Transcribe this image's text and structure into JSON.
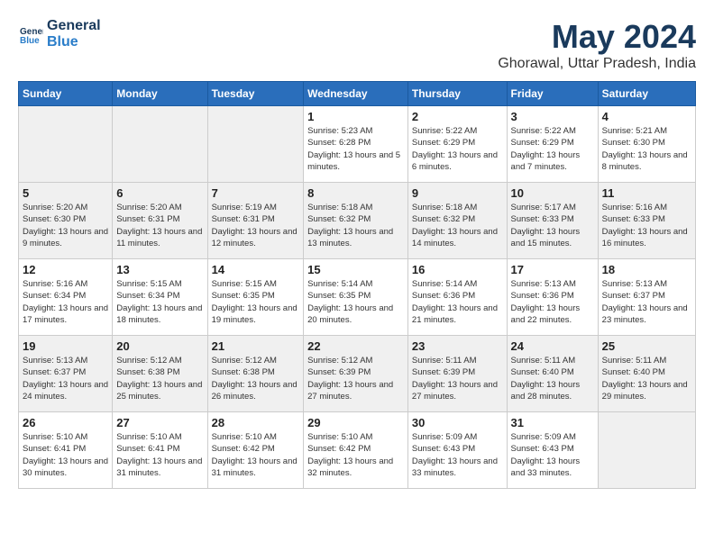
{
  "logo": {
    "line1": "General",
    "line2": "Blue"
  },
  "title": "May 2024",
  "subtitle": "Ghorawal, Uttar Pradesh, India",
  "days_of_week": [
    "Sunday",
    "Monday",
    "Tuesday",
    "Wednesday",
    "Thursday",
    "Friday",
    "Saturday"
  ],
  "weeks": [
    {
      "days": [
        {
          "num": "",
          "empty": true
        },
        {
          "num": "",
          "empty": true
        },
        {
          "num": "",
          "empty": true
        },
        {
          "num": "1",
          "sunrise": "5:23 AM",
          "sunset": "6:28 PM",
          "daylight": "13 hours and 5 minutes."
        },
        {
          "num": "2",
          "sunrise": "5:22 AM",
          "sunset": "6:29 PM",
          "daylight": "13 hours and 6 minutes."
        },
        {
          "num": "3",
          "sunrise": "5:22 AM",
          "sunset": "6:29 PM",
          "daylight": "13 hours and 7 minutes."
        },
        {
          "num": "4",
          "sunrise": "5:21 AM",
          "sunset": "6:30 PM",
          "daylight": "13 hours and 8 minutes."
        }
      ]
    },
    {
      "days": [
        {
          "num": "5",
          "sunrise": "5:20 AM",
          "sunset": "6:30 PM",
          "daylight": "13 hours and 9 minutes."
        },
        {
          "num": "6",
          "sunrise": "5:20 AM",
          "sunset": "6:31 PM",
          "daylight": "13 hours and 11 minutes."
        },
        {
          "num": "7",
          "sunrise": "5:19 AM",
          "sunset": "6:31 PM",
          "daylight": "13 hours and 12 minutes."
        },
        {
          "num": "8",
          "sunrise": "5:18 AM",
          "sunset": "6:32 PM",
          "daylight": "13 hours and 13 minutes."
        },
        {
          "num": "9",
          "sunrise": "5:18 AM",
          "sunset": "6:32 PM",
          "daylight": "13 hours and 14 minutes."
        },
        {
          "num": "10",
          "sunrise": "5:17 AM",
          "sunset": "6:33 PM",
          "daylight": "13 hours and 15 minutes."
        },
        {
          "num": "11",
          "sunrise": "5:16 AM",
          "sunset": "6:33 PM",
          "daylight": "13 hours and 16 minutes."
        }
      ]
    },
    {
      "days": [
        {
          "num": "12",
          "sunrise": "5:16 AM",
          "sunset": "6:34 PM",
          "daylight": "13 hours and 17 minutes."
        },
        {
          "num": "13",
          "sunrise": "5:15 AM",
          "sunset": "6:34 PM",
          "daylight": "13 hours and 18 minutes."
        },
        {
          "num": "14",
          "sunrise": "5:15 AM",
          "sunset": "6:35 PM",
          "daylight": "13 hours and 19 minutes."
        },
        {
          "num": "15",
          "sunrise": "5:14 AM",
          "sunset": "6:35 PM",
          "daylight": "13 hours and 20 minutes."
        },
        {
          "num": "16",
          "sunrise": "5:14 AM",
          "sunset": "6:36 PM",
          "daylight": "13 hours and 21 minutes."
        },
        {
          "num": "17",
          "sunrise": "5:13 AM",
          "sunset": "6:36 PM",
          "daylight": "13 hours and 22 minutes."
        },
        {
          "num": "18",
          "sunrise": "5:13 AM",
          "sunset": "6:37 PM",
          "daylight": "13 hours and 23 minutes."
        }
      ]
    },
    {
      "days": [
        {
          "num": "19",
          "sunrise": "5:13 AM",
          "sunset": "6:37 PM",
          "daylight": "13 hours and 24 minutes."
        },
        {
          "num": "20",
          "sunrise": "5:12 AM",
          "sunset": "6:38 PM",
          "daylight": "13 hours and 25 minutes."
        },
        {
          "num": "21",
          "sunrise": "5:12 AM",
          "sunset": "6:38 PM",
          "daylight": "13 hours and 26 minutes."
        },
        {
          "num": "22",
          "sunrise": "5:12 AM",
          "sunset": "6:39 PM",
          "daylight": "13 hours and 27 minutes."
        },
        {
          "num": "23",
          "sunrise": "5:11 AM",
          "sunset": "6:39 PM",
          "daylight": "13 hours and 27 minutes."
        },
        {
          "num": "24",
          "sunrise": "5:11 AM",
          "sunset": "6:40 PM",
          "daylight": "13 hours and 28 minutes."
        },
        {
          "num": "25",
          "sunrise": "5:11 AM",
          "sunset": "6:40 PM",
          "daylight": "13 hours and 29 minutes."
        }
      ]
    },
    {
      "days": [
        {
          "num": "26",
          "sunrise": "5:10 AM",
          "sunset": "6:41 PM",
          "daylight": "13 hours and 30 minutes."
        },
        {
          "num": "27",
          "sunrise": "5:10 AM",
          "sunset": "6:41 PM",
          "daylight": "13 hours and 31 minutes."
        },
        {
          "num": "28",
          "sunrise": "5:10 AM",
          "sunset": "6:42 PM",
          "daylight": "13 hours and 31 minutes."
        },
        {
          "num": "29",
          "sunrise": "5:10 AM",
          "sunset": "6:42 PM",
          "daylight": "13 hours and 32 minutes."
        },
        {
          "num": "30",
          "sunrise": "5:09 AM",
          "sunset": "6:43 PM",
          "daylight": "13 hours and 33 minutes."
        },
        {
          "num": "31",
          "sunrise": "5:09 AM",
          "sunset": "6:43 PM",
          "daylight": "13 hours and 33 minutes."
        },
        {
          "num": "",
          "empty": true
        }
      ]
    }
  ]
}
